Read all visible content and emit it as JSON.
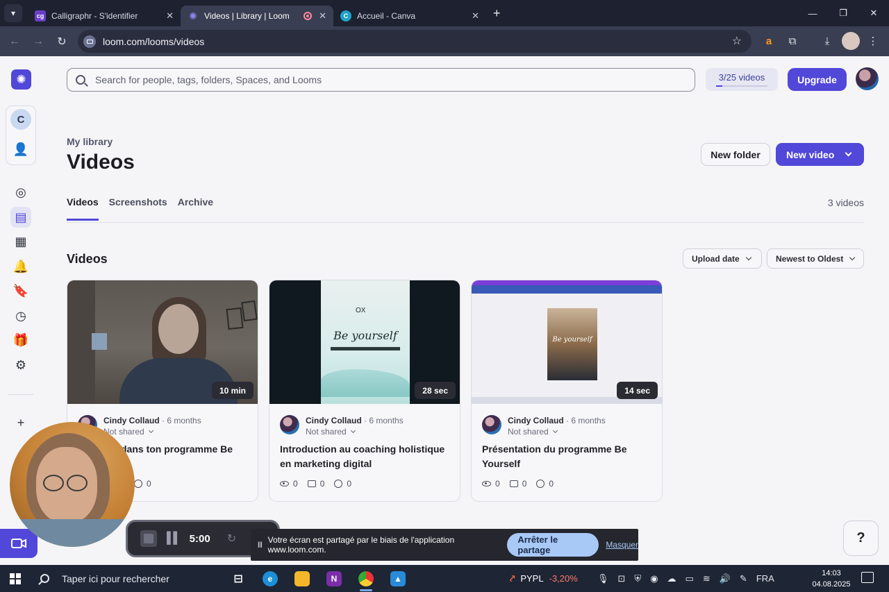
{
  "browser": {
    "tabs": [
      {
        "label": "Calligraphr - S'identifier",
        "favicon": "cg"
      },
      {
        "label": "Videos | Library | Loom",
        "favicon": "loom"
      },
      {
        "label": "Accueil - Canva",
        "favicon": "C"
      }
    ],
    "url": "loom.com/looms/videos"
  },
  "search": {
    "placeholder": "Search for people, tags, folders, Spaces, and Looms"
  },
  "quota": {
    "label": "3/25 videos",
    "used": 3,
    "total": 25
  },
  "upgrade_label": "Upgrade",
  "sidebar": {
    "workspace_initial": "C"
  },
  "header": {
    "eyebrow": "My library",
    "title": "Videos",
    "new_folder": "New folder",
    "new_video": "New video"
  },
  "tabs": [
    {
      "label": "Videos",
      "active": true
    },
    {
      "label": "Screenshots",
      "active": false
    },
    {
      "label": "Archive",
      "active": false
    }
  ],
  "count_label": "3 videos",
  "section": {
    "title": "Videos",
    "sort_field": "Upload date",
    "sort_order": "Newest to Oldest"
  },
  "videos": [
    {
      "duration": "10 min",
      "author": "Cindy Collaud",
      "ago": "· 6 months",
      "sharing": "Not shared",
      "title": "dans ton programme Be",
      "views": "0",
      "comments": "0",
      "reactions": "0"
    },
    {
      "duration": "28 sec",
      "author": "Cindy Collaud",
      "ago": "· 6 months",
      "sharing": "Not shared",
      "title": "Introduction au coaching holistique en marketing digital",
      "views": "0",
      "comments": "0",
      "reactions": "0"
    },
    {
      "duration": "14 sec",
      "author": "Cindy Collaud",
      "ago": "· 6 months",
      "sharing": "Not shared",
      "title": "Présentation du programme Be Yourself",
      "views": "0",
      "comments": "0",
      "reactions": "0"
    }
  ],
  "recording": {
    "time": "5:00"
  },
  "sharebar": {
    "pause_glyph": "II",
    "message": "Votre écran est partagé par le biais de l'application www.loom.com.",
    "stop_label": "Arrêter le partage",
    "hide_label": "Masquer"
  },
  "help_label": "?",
  "taskbar": {
    "search_placeholder": "Taper ici pour rechercher",
    "stock_symbol": "PYPL",
    "stock_change": "-3,20%",
    "language": "FRA",
    "time": "14:03",
    "date": "04.08.2025"
  },
  "colors": {
    "accent": "#5147d8",
    "text": "#1c1c22",
    "muted": "#54566a"
  }
}
